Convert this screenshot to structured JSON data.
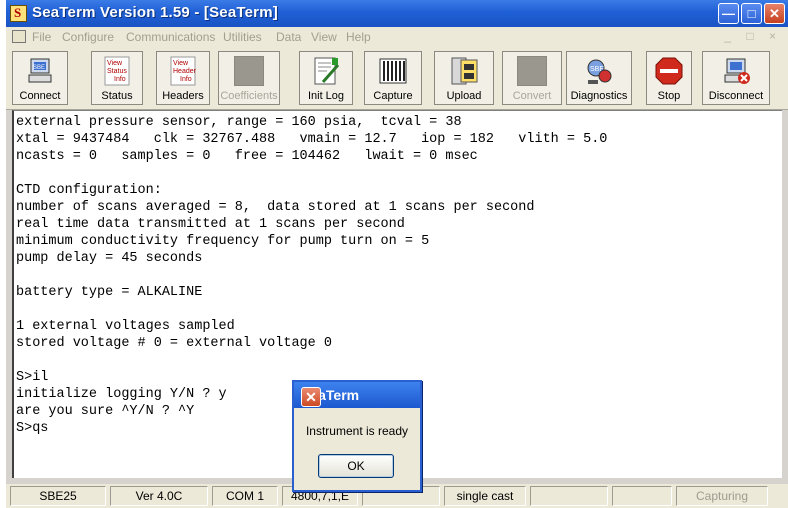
{
  "window": {
    "title": "SeaTerm Version 1.59 - [SeaTerm]"
  },
  "menu": [
    "File",
    "Configure",
    "Communications",
    "Utilities",
    "Data",
    "View",
    "Help"
  ],
  "toolbar": [
    {
      "label": "Connect",
      "icon": "connect-icon",
      "enabled": true
    },
    {
      "label": "Status",
      "icon": "view-status-info-icon",
      "enabled": true
    },
    {
      "label": "Headers",
      "icon": "view-header-info-icon",
      "enabled": true
    },
    {
      "label": "Coefficients",
      "icon": "coefficients-icon",
      "enabled": false
    },
    {
      "label": "Init Log",
      "icon": "init-log-icon",
      "enabled": true
    },
    {
      "label": "Capture",
      "icon": "capture-icon",
      "enabled": true
    },
    {
      "label": "Upload",
      "icon": "upload-icon",
      "enabled": true
    },
    {
      "label": "Convert",
      "icon": "convert-icon",
      "enabled": false
    },
    {
      "label": "Diagnostics",
      "icon": "diagnostics-icon",
      "enabled": true
    },
    {
      "label": "Stop",
      "icon": "stop-icon",
      "enabled": true
    },
    {
      "label": "Disconnect",
      "icon": "disconnect-icon",
      "enabled": true
    }
  ],
  "icon_text": {
    "view": "View",
    "status": "Status",
    "info": "Info",
    "header": "Header",
    "sbe": "SBE"
  },
  "terminal_lines": [
    "external pressure sensor, range = 160 psia,  tcval = 38",
    "xtal = 9437484   clk = 32767.488   vmain = 12.7   iop = 182   vlith = 5.0",
    "ncasts = 0   samples = 0   free = 104462   lwait = 0 msec",
    "",
    "CTD configuration:",
    "number of scans averaged = 8,  data stored at 1 scans per second",
    "real time data transmitted at 1 scans per second",
    "minimum conductivity frequency for pump turn on = 5",
    "pump delay = 45 seconds",
    "",
    "battery type = ALKALINE",
    "",
    "1 external voltages sampled",
    "stored voltage # 0 = external voltage 0",
    "",
    "S>il",
    "initialize logging Y/N ? y",
    "are you sure ^Y/N ? ^Y",
    "S>qs"
  ],
  "dialog": {
    "title": "SeaTerm",
    "message": "Instrument is ready",
    "ok_label": "OK"
  },
  "statusbar": [
    "SBE25",
    "Ver 4.0C",
    "COM 1",
    "4800,7,1,E",
    "",
    "single cast",
    "",
    "",
    "Capturing"
  ],
  "colors": {
    "title_blue": "#1f5fd6",
    "stop_red": "#d02a1c",
    "dialog_blue": "#2a5fcf"
  }
}
